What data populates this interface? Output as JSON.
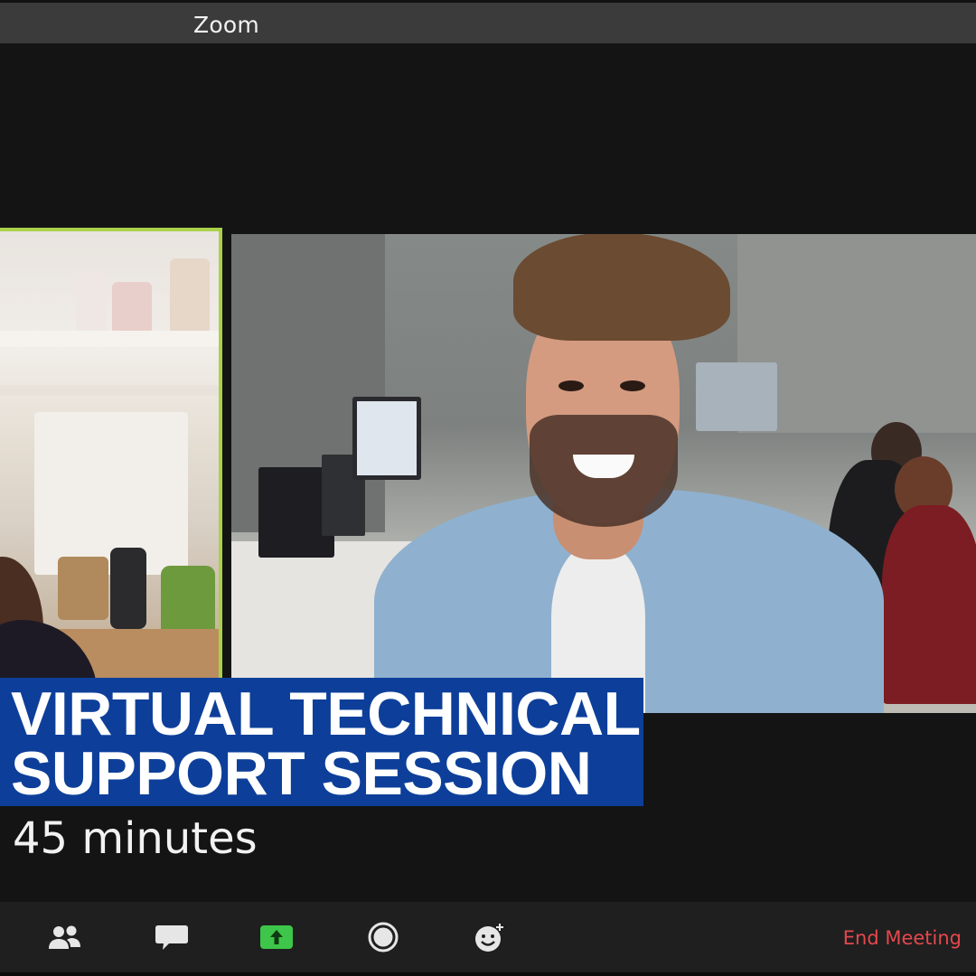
{
  "window": {
    "title": "Zoom"
  },
  "overlay": {
    "headline_line1": "VIRTUAL TECHNICAL",
    "headline_line2": "SUPPORT SESSION",
    "duration": "45 minutes"
  },
  "toolbar": {
    "icons": [
      "participants-icon",
      "chat-icon",
      "share-screen-icon",
      "record-icon",
      "reactions-icon"
    ],
    "end_meeting_label": "End Meeting"
  },
  "colors": {
    "active_speaker_border": "#a9d14a",
    "banner_bg": "#0d3f9a",
    "share_green": "#3ec64a",
    "end_meeting_red": "#e5484d"
  }
}
